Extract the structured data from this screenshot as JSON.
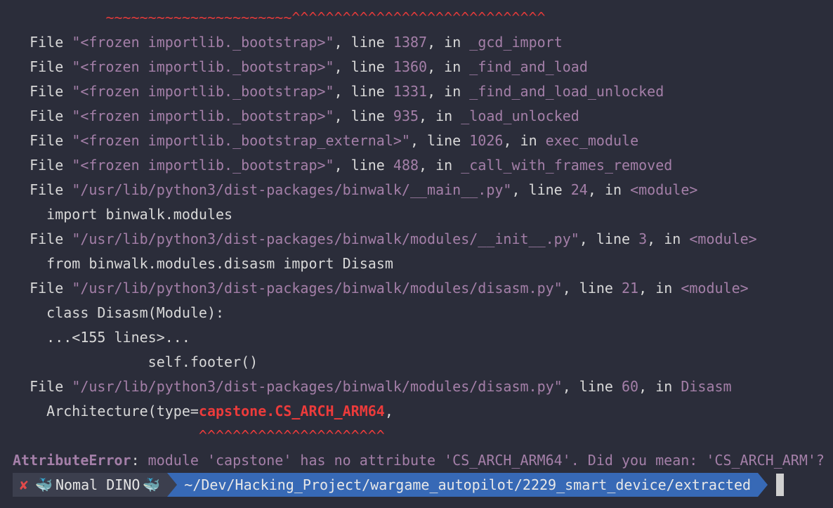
{
  "traceback": {
    "squiggle_tildes": "~~~~~~~~~~~~~~~~~~~~~~",
    "squiggle_carets": "^^^^^^^^^^^^^^^^^^^^^^^^^^^^^^",
    "frames": [
      {
        "file": "\"<frozen importlib._bootstrap>\"",
        "line": "1387",
        "func": "_gcd_import"
      },
      {
        "file": "\"<frozen importlib._bootstrap>\"",
        "line": "1360",
        "func": "_find_and_load"
      },
      {
        "file": "\"<frozen importlib._bootstrap>\"",
        "line": "1331",
        "func": "_find_and_load_unlocked"
      },
      {
        "file": "\"<frozen importlib._bootstrap>\"",
        "line": "935",
        "func": "_load_unlocked"
      },
      {
        "file": "\"<frozen importlib._bootstrap_external>\"",
        "line": "1026",
        "func": "exec_module"
      },
      {
        "file": "\"<frozen importlib._bootstrap>\"",
        "line": "488",
        "func": "_call_with_frames_removed"
      },
      {
        "file": "\"/usr/lib/python3/dist-packages/binwalk/__main__.py\"",
        "line": "24",
        "func": "<module>",
        "code": "import binwalk.modules"
      },
      {
        "file": "\"/usr/lib/python3/dist-packages/binwalk/modules/__init__.py\"",
        "line": "3",
        "func": "<module>",
        "code": "from binwalk.modules.disasm import Disasm"
      },
      {
        "file": "\"/usr/lib/python3/dist-packages/binwalk/modules/disasm.py\"",
        "line": "21",
        "func": "<module>",
        "code": "class Disasm(Module):"
      }
    ],
    "elided": "...<155 lines>...",
    "elided_code": "self.footer()",
    "last_frame": {
      "file": "\"/usr/lib/python3/dist-packages/binwalk/modules/disasm.py\"",
      "line": "60",
      "func": "Disasm"
    },
    "last_code_prefix": "Architecture(type=",
    "last_code_highlight": "capstone.CS_ARCH_ARM64",
    "last_code_suffix": ",",
    "last_carets": "^^^^^^^^^^^^^^^^^^^^^^",
    "labels": {
      "file": "File ",
      "line": "line ",
      "in": "in "
    },
    "error_name": "AttributeError",
    "error_message": "module 'capstone' has no attribute 'CS_ARCH_ARM64'. Did you mean: 'CS_ARCH_ARM'?"
  },
  "prompt": {
    "status_icon": "✘",
    "whale_icon": "🐳",
    "user_label": "Nomal DINO",
    "path": "~/Dev/Hacking_Project/wargame_autopilot/2229_smart_device/extracted"
  },
  "colors": {
    "background": "#2b2d3a",
    "accent_error": "#ec3b3b",
    "string": "#a47fa8",
    "prompt_path_bg": "#3769b6",
    "prompt_user_bg": "#3c3f4e"
  }
}
